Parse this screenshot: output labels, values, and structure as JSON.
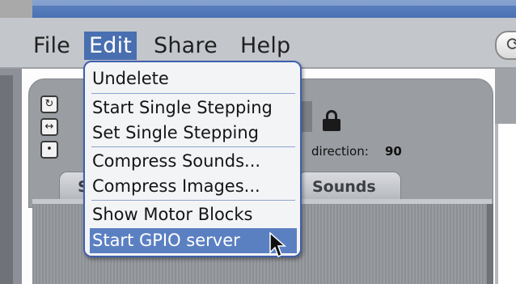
{
  "menubar": {
    "items": [
      "File",
      "Edit",
      "Share",
      "Help"
    ]
  },
  "edit_menu": {
    "items": [
      "Undelete",
      "Start Single Stepping",
      "Set Single Stepping",
      "Compress Sounds...",
      "Compress Images...",
      "Show Motor Blocks",
      "Start GPIO server"
    ],
    "highlighted": "Start GPIO server"
  },
  "sprite": {
    "direction_label": "direction:",
    "direction_value": "90"
  },
  "tabs": {
    "scripts_partial": "S",
    "sounds": "Sounds"
  },
  "colors": {
    "menu_highlight": "#5b80c2",
    "menu_active": "#496fb0",
    "menu_border": "#3f5fae"
  }
}
